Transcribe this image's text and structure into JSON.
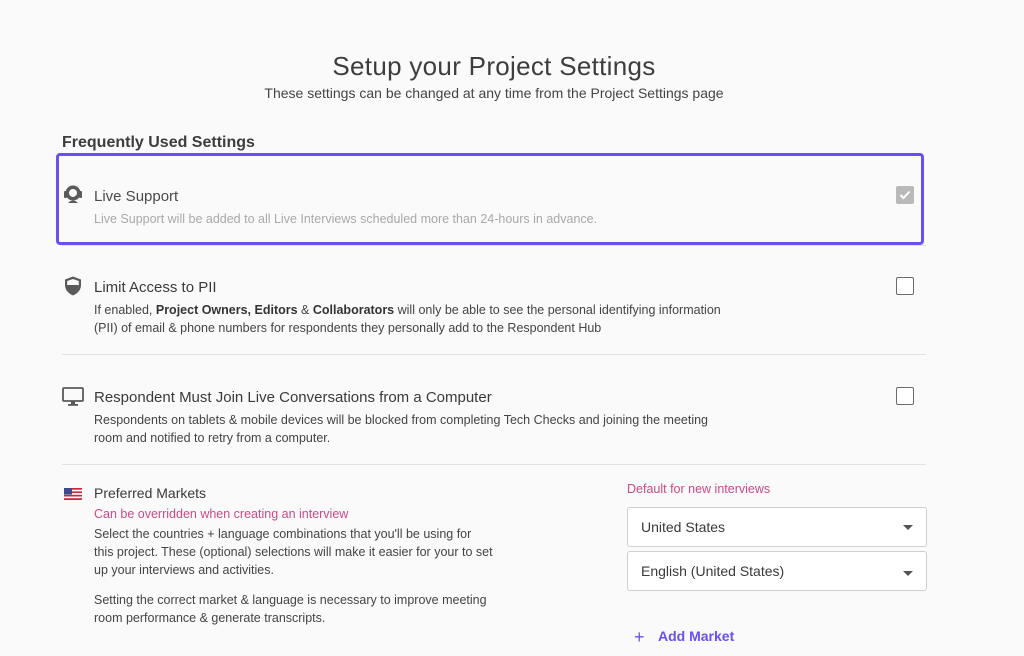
{
  "header": {
    "title": "Setup your Project Settings",
    "subtitle": "These settings can be changed at any time from the Project Settings page"
  },
  "section": {
    "heading": "Frequently Used Settings"
  },
  "settings": {
    "live_support": {
      "label": "Live Support",
      "description": "Live Support will be added to all Live Interviews scheduled more than 24-hours in advance.",
      "checked": true,
      "disabled": true,
      "icon": "headset-icon"
    },
    "limit_pii": {
      "label": "Limit Access to PII",
      "desc_prefix": "If enabled, ",
      "desc_bold1": "Project Owners, Editors",
      "desc_amp": " & ",
      "desc_bold2": "Collaborators",
      "desc_suffix": " will only be able to see the personal identifying information (PII) of email & phone numbers for respondents they personally add to the Respondent Hub",
      "checked": false,
      "icon": "shield-icon"
    },
    "computer_only": {
      "label": "Respondent Must Join Live Conversations from a Computer",
      "description": "Respondents on tablets & mobile devices will be blocked from completing Tech Checks and joining the meeting room and notified to retry from a computer.",
      "checked": false,
      "icon": "monitor-icon"
    }
  },
  "markets": {
    "label": "Preferred Markets",
    "note": "Can be overridden when creating an interview",
    "description": "Select the countries + language combinations that you'll be using for this project. These (optional) selections will make it easier for your to set up your interviews and activities.",
    "description2": "Setting the correct market & language is necessary to improve meeting room performance & generate transcripts.",
    "icon": "us-flag-icon",
    "default_label": "Default for new interviews",
    "country": "United States",
    "language": "English (United States)",
    "add_label": "Add Market"
  },
  "colors": {
    "accent": "#6b4ff0",
    "pink": "#c94b86"
  }
}
